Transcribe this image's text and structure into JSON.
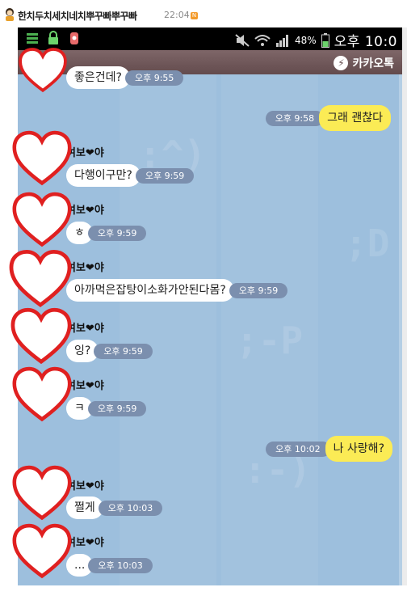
{
  "header": {
    "nickname": "한치두치세치네치뿌꾸빠뿌꾸빠",
    "time": "22:04",
    "badge": "N"
  },
  "statusbar": {
    "battery_pct": "48%",
    "clock": "오후 10:0"
  },
  "topbar": {
    "app_name": "카카오톡",
    "bolt_glyph": "⚡"
  },
  "background_faces": [
    ":^)",
    ";D",
    ";-P",
    ":-)"
  ],
  "messages": [
    {
      "side": "left",
      "sender": "",
      "text": "좋은건데?",
      "time": "오후 9:55"
    },
    {
      "side": "right",
      "sender": "",
      "text": "그래 괜찮다",
      "time": "오후 9:58"
    },
    {
      "side": "left",
      "sender": "여보❤야",
      "text": "다행이구만?",
      "time": "오후 9:59"
    },
    {
      "side": "left",
      "sender": "여보❤야",
      "text": "ㅎ",
      "time": "오후 9:59"
    },
    {
      "side": "left",
      "sender": "여보❤야",
      "text": "아까먹은잡탕이소화가안된다몸?",
      "time": "오후 9:59"
    },
    {
      "side": "left",
      "sender": "여보❤야",
      "text": "잉?",
      "time": "오후 9:59"
    },
    {
      "side": "left",
      "sender": "여보❤야",
      "text": "ㅋ",
      "time": "오후 9:59"
    },
    {
      "side": "right",
      "sender": "",
      "text": "나 사랑해?",
      "time": "오후 10:02"
    },
    {
      "side": "left",
      "sender": "여보❤야",
      "text": "쩔게",
      "time": "오후 10:03"
    },
    {
      "side": "left",
      "sender": "여보❤야",
      "text": "...",
      "time": "오후 10:03"
    }
  ],
  "colors": {
    "chat_bg": "#9dbfdd",
    "my_bubble": "#fbeb55",
    "their_bubble": "#ffffff",
    "timestamp_pill": "#7b8fae",
    "heart": "#e02020"
  }
}
